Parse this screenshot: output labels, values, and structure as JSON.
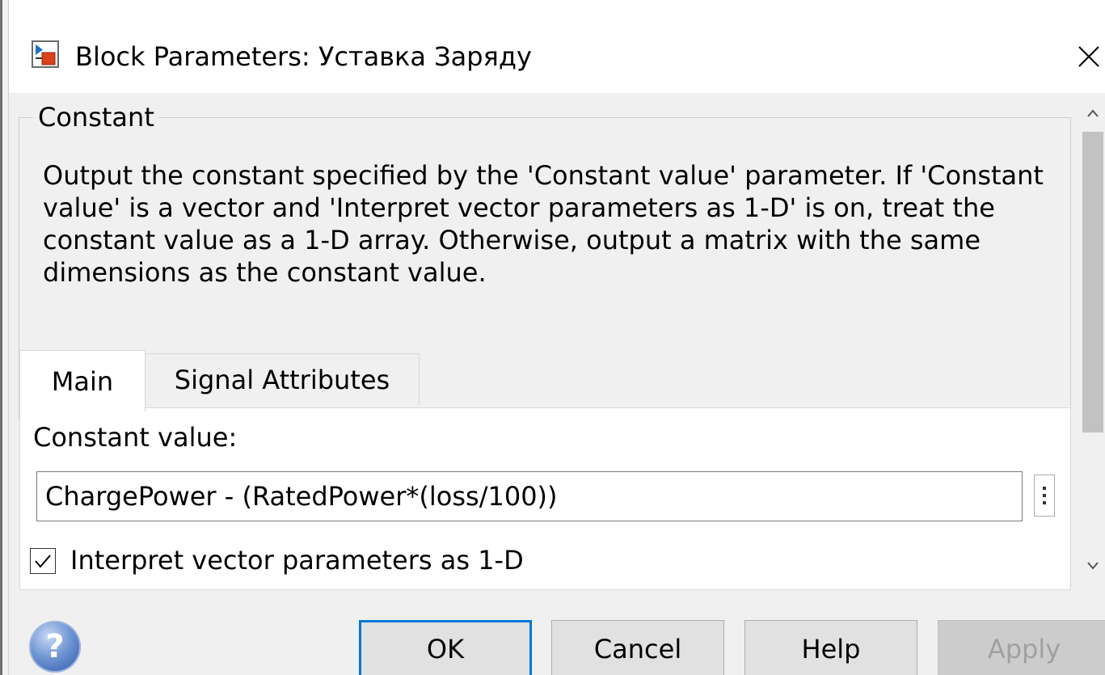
{
  "window": {
    "title": "Block Parameters: Уставка Заряду",
    "icon": "simulink-block-icon",
    "close_icon": "close-icon"
  },
  "group": {
    "legend": "Constant",
    "description": "Output the constant specified by the 'Constant value' parameter. If 'Constant value' is a vector and 'Interpret vector parameters as 1-D' is on, treat the constant value as a 1-D array. Otherwise, output a matrix with the same dimensions as the constant value."
  },
  "tabs": [
    {
      "label": "Main",
      "active": true
    },
    {
      "label": "Signal Attributes",
      "active": false
    }
  ],
  "main": {
    "constant_label": "Constant value:",
    "constant_value": "ChargePower - (RatedPower*(loss/100))",
    "checkbox_label": "Interpret vector parameters as 1-D",
    "checkbox_checked": true
  },
  "buttons": {
    "ok": "OK",
    "cancel": "Cancel",
    "help": "Help",
    "apply": "Apply",
    "apply_enabled": false
  },
  "icons": {
    "help": "help-question-icon",
    "more": "vertical-ellipsis-icon",
    "scroll_up": "chevron-up-icon",
    "scroll_down": "chevron-down-icon",
    "check": "checkmark-icon"
  },
  "colors": {
    "accent": "#0078d7",
    "dialog_bg": "#f0f0f0",
    "titlebar_bg": "#ffffff"
  }
}
